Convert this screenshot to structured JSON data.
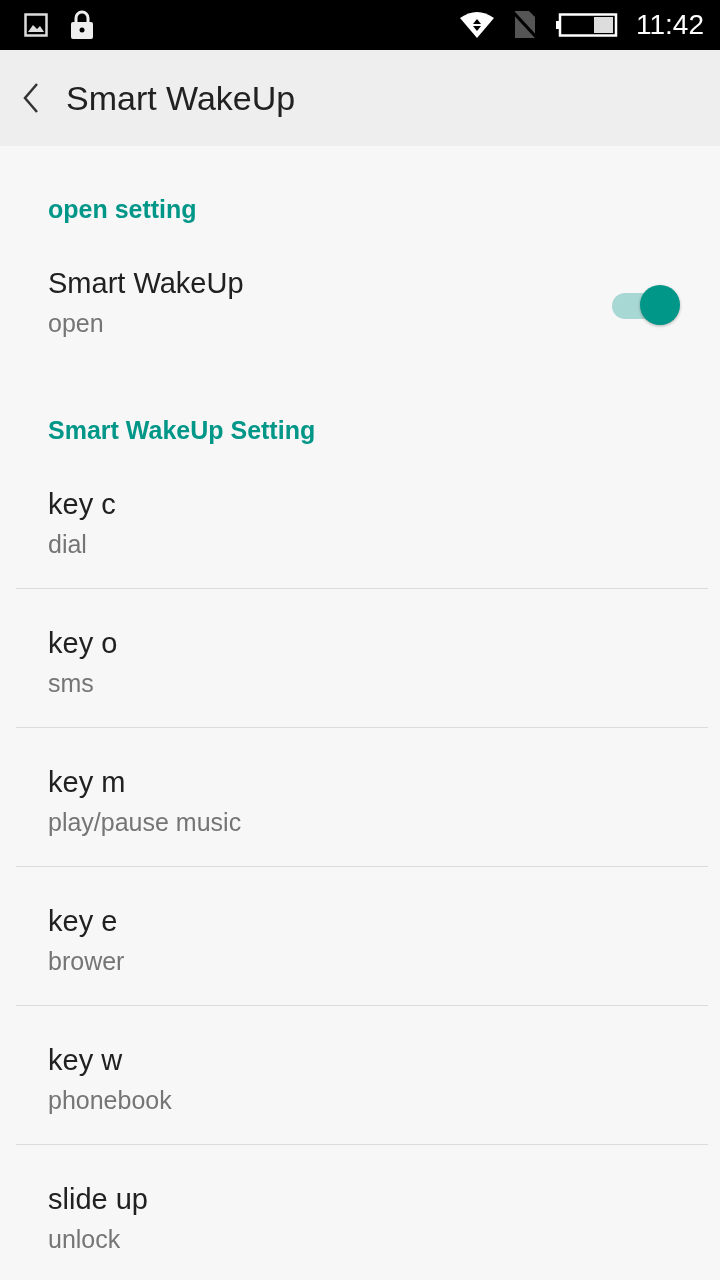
{
  "status_bar": {
    "time": "11:42"
  },
  "toolbar": {
    "title": "Smart WakeUp"
  },
  "sections": [
    {
      "header": "open setting",
      "items": [
        {
          "kind": "switch",
          "title": "Smart WakeUp",
          "summary": "open",
          "on": true
        }
      ]
    },
    {
      "header": "Smart WakeUp Setting",
      "items": [
        {
          "kind": "plain",
          "title": "key c",
          "summary": "dial"
        },
        {
          "kind": "plain",
          "title": "key o",
          "summary": "sms"
        },
        {
          "kind": "plain",
          "title": "key m",
          "summary": "play/pause music"
        },
        {
          "kind": "plain",
          "title": "key e",
          "summary": "brower"
        },
        {
          "kind": "plain",
          "title": "key w",
          "summary": "phonebook"
        },
        {
          "kind": "plain",
          "title": "slide up",
          "summary": "unlock"
        }
      ]
    }
  ]
}
